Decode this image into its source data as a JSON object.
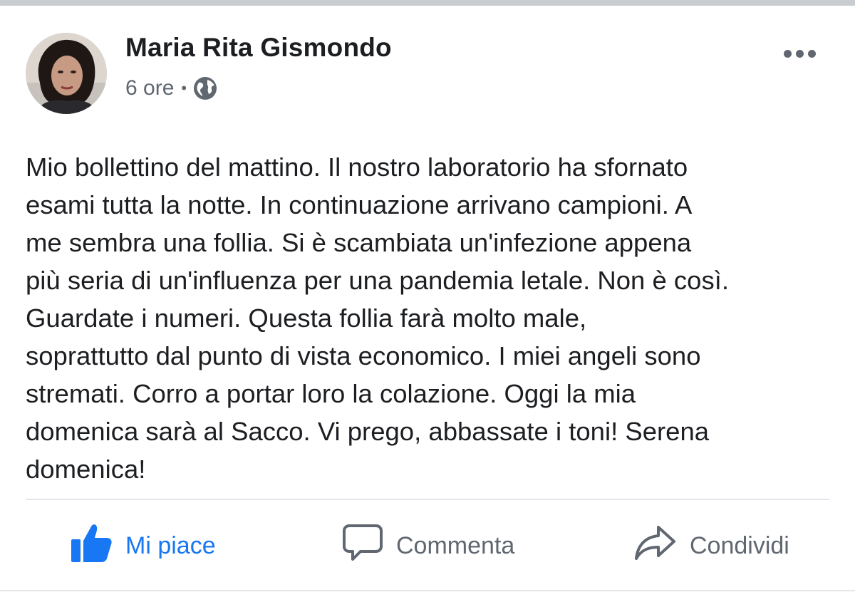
{
  "post": {
    "author": "Maria Rita Gismondo",
    "time": "6 ore",
    "separator": "•",
    "privacy_icon": "globe-icon",
    "more_icon": "more-options-icon",
    "text_lines": [
      "Mio bollettino del mattino. Il nostro laboratorio ha sfornato",
      "esami tutta la notte. In continuazione arrivano campioni. A",
      "me sembra una follia. Si è scambiata un'infezione appena",
      "più seria di un'influenza per una pandemia letale. Non è così.",
      "Guardate i numeri. Questa follia farà molto male,",
      "soprattutto dal punto di vista economico. I miei angeli sono",
      "stremati. Corro a portar loro la colazione. Oggi la mia",
      "domenica sarà al Sacco. Vi prego, abbassate i toni! Serena",
      "domenica!"
    ]
  },
  "actions": {
    "like": {
      "label": "Mi piace",
      "icon": "thumbs-up-icon",
      "color": "#1877f2"
    },
    "comment": {
      "label": "Commenta",
      "icon": "comment-bubble-icon"
    },
    "share": {
      "label": "Condividi",
      "icon": "share-arrow-icon"
    }
  },
  "colors": {
    "text": "#1c1e21",
    "secondary": "#606770",
    "accent": "#1877f2",
    "divider": "#e4e6eb"
  }
}
